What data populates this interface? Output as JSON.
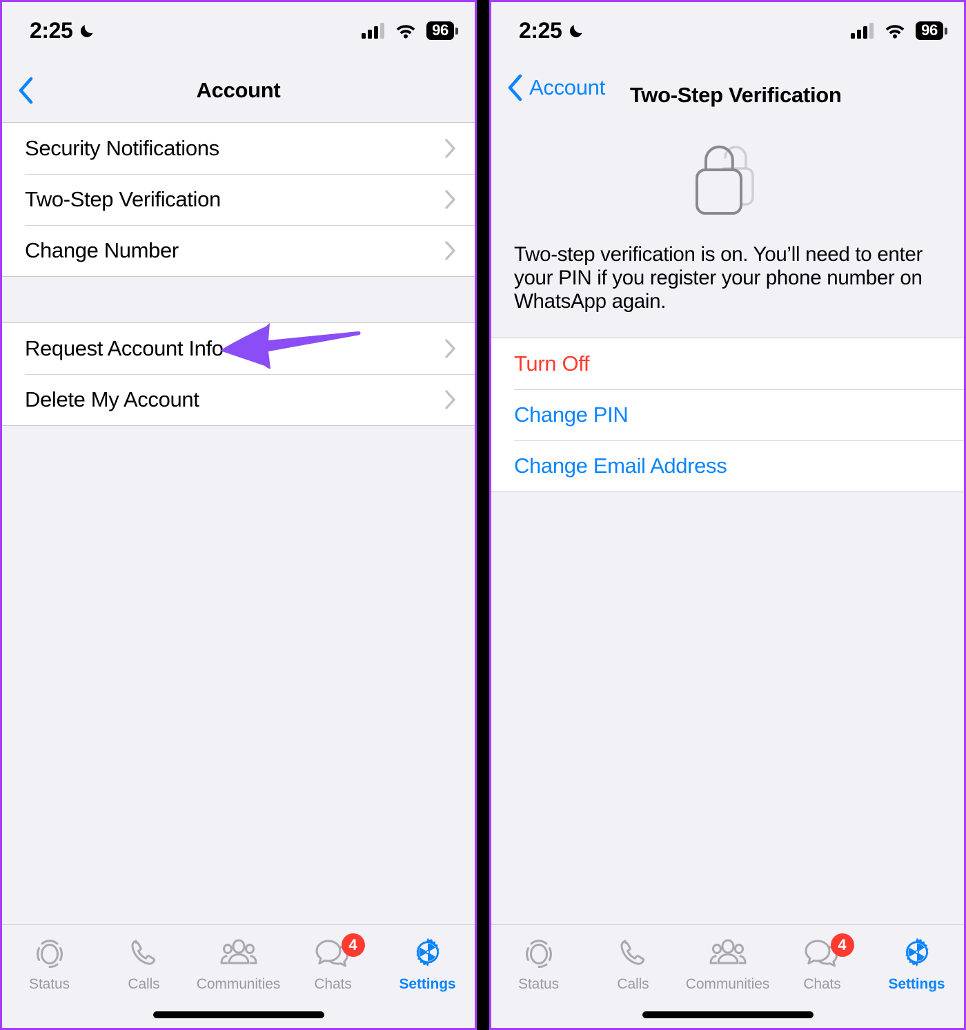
{
  "colors": {
    "accent_blue": "#0A84FF",
    "danger_red": "#FF3B30",
    "annotation_purple": "#8B4DF5",
    "frame_purple": "#A83CFF",
    "background_gray": "#F2F1F6",
    "row_white": "#FFFFFF",
    "chevron_gray": "#C2C1C6",
    "tab_inactive": "#9B9AA0"
  },
  "left_panel": {
    "status_bar": {
      "time": "2:25",
      "moon_icon": "crescent-moon-icon",
      "cellular_icon": "cellular-bars-icon",
      "wifi_icon": "wifi-icon",
      "battery_level": "96"
    },
    "nav": {
      "back_icon": "chevron-left-icon",
      "back_label": "",
      "title": "Account"
    },
    "groups": [
      {
        "items": [
          {
            "label": "Security Notifications",
            "chevron": "chevron-right-icon"
          },
          {
            "label": "Two-Step Verification",
            "chevron": "chevron-right-icon"
          },
          {
            "label": "Change Number",
            "chevron": "chevron-right-icon"
          }
        ]
      },
      {
        "items": [
          {
            "label": "Request Account Info",
            "chevron": "chevron-right-icon"
          },
          {
            "label": "Delete My Account",
            "chevron": "chevron-right-icon"
          }
        ]
      }
    ],
    "annotation": {
      "type": "arrow-left-annotation",
      "points_at": "Two-Step Verification"
    }
  },
  "right_panel": {
    "status_bar": {
      "time": "2:25",
      "moon_icon": "crescent-moon-icon",
      "cellular_icon": "cellular-bars-icon",
      "wifi_icon": "wifi-icon",
      "battery_level": "96"
    },
    "nav": {
      "back_icon": "chevron-left-icon",
      "back_label": "Account",
      "title": "Two-Step Verification"
    },
    "hero_icon": "double-lock-icon",
    "description": "Two-step verification is on. You’ll need to enter your PIN if you register your phone number on WhatsApp again.",
    "actions": [
      {
        "label": "Turn Off",
        "style": "danger"
      },
      {
        "label": "Change PIN",
        "style": "link"
      },
      {
        "label": "Change Email Address",
        "style": "link"
      }
    ],
    "annotation": {
      "type": "arrow-left-annotation",
      "points_at": "Turn Off"
    }
  },
  "tabbar": {
    "items": [
      {
        "label": "Status",
        "icon": "status-rings-icon",
        "active": false,
        "badge": ""
      },
      {
        "label": "Calls",
        "icon": "phone-handset-icon",
        "active": false,
        "badge": ""
      },
      {
        "label": "Communities",
        "icon": "communities-people-icon",
        "active": false,
        "badge": ""
      },
      {
        "label": "Chats",
        "icon": "chat-bubbles-icon",
        "active": false,
        "badge": "4"
      },
      {
        "label": "Settings",
        "icon": "gear-icon",
        "active": true,
        "badge": ""
      }
    ]
  }
}
